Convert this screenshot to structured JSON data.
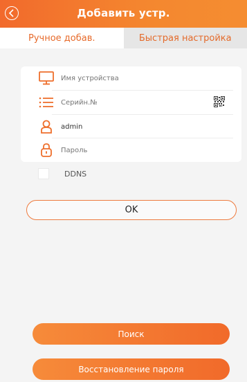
{
  "header": {
    "title": "Добавить устр."
  },
  "tabs": [
    {
      "label": "Ручное добав.",
      "active": true
    },
    {
      "label": "Быстрая настройка",
      "active": false
    }
  ],
  "form": {
    "device_name_placeholder": "Имя устройства",
    "serial_placeholder": "Серийн.№",
    "username_value": "admin",
    "password_placeholder": "Пароль"
  },
  "ddns": {
    "label": "DDNS",
    "checked": false
  },
  "buttons": {
    "ok": "OK",
    "search": "Поиск",
    "restore_password": "Восстановление пароля"
  },
  "colors": {
    "accent": "#f26a2c"
  }
}
